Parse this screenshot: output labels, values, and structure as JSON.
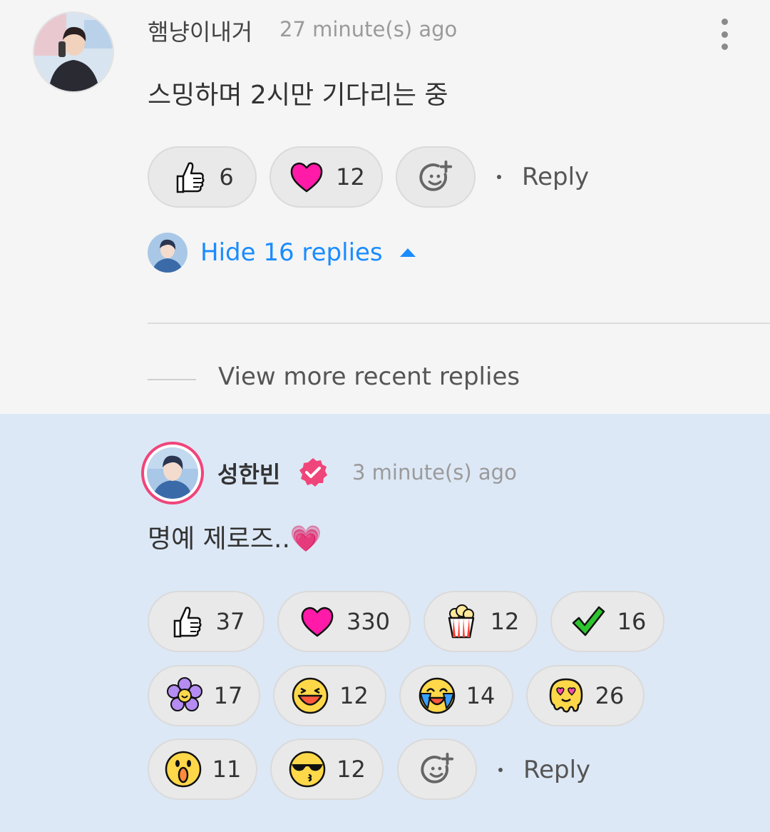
{
  "comment": {
    "author": "햄냥이내거",
    "time": "27 minute(s) ago",
    "text": "스밍하며 2시만 기다리는 중",
    "reactions": [
      {
        "icon": "thumbs-up-icon",
        "count": "6"
      },
      {
        "icon": "heart-icon",
        "count": "12"
      }
    ],
    "reply_label": "Reply",
    "hide_replies_label": "Hide 16 replies"
  },
  "thread": {
    "view_more_label": "View more recent replies"
  },
  "reply": {
    "author": "성한빈",
    "time": "3 minute(s) ago",
    "text": "명예 제로즈..💗",
    "reactions": [
      {
        "icon": "thumbs-up-icon",
        "count": "37"
      },
      {
        "icon": "heart-icon",
        "count": "330"
      },
      {
        "icon": "popcorn-icon",
        "count": "12"
      },
      {
        "icon": "checkmark-icon",
        "count": "16"
      },
      {
        "icon": "flower-icon",
        "count": "17"
      },
      {
        "icon": "laughing-face-icon",
        "count": "12"
      },
      {
        "icon": "crying-laughing-face-icon",
        "count": "14"
      },
      {
        "icon": "heart-eyes-melting-face-icon",
        "count": "26"
      },
      {
        "icon": "surprised-face-icon",
        "count": "11"
      },
      {
        "icon": "sunglasses-kiss-face-icon",
        "count": "12"
      }
    ],
    "reply_label": "Reply"
  },
  "colors": {
    "link_blue": "#1a8cff",
    "verified_pink": "#f0457a",
    "reply_bg": "#dde8f6"
  }
}
